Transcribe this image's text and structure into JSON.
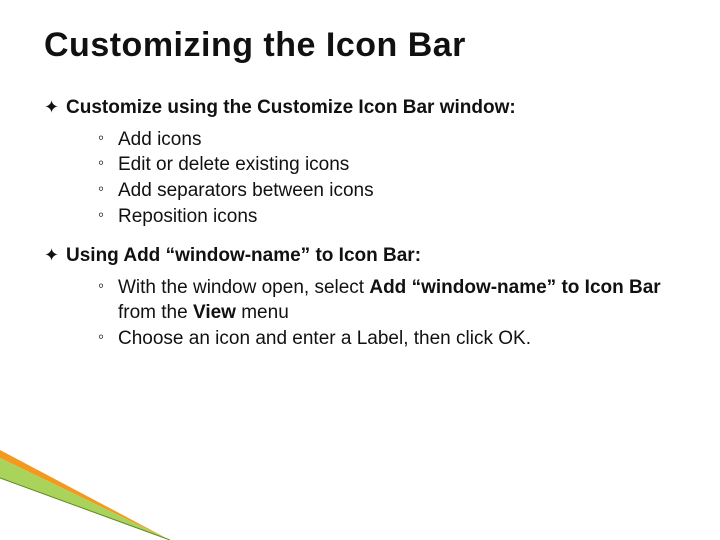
{
  "title": "Customizing the Icon Bar",
  "b1": {
    "text": "Customize using the Customize Icon Bar window:"
  },
  "s1": {
    "a": "Add icons",
    "b": "Edit or delete existing icons",
    "c": "Add separators between icons",
    "d": "Reposition icons"
  },
  "b2": {
    "text": "Using Add “window-name” to Icon Bar:"
  },
  "s2": {
    "a_pre": "With the window open, select ",
    "a_bold": "Add “window-name” to Icon Bar",
    "a_mid": " from the ",
    "a_bold2": "View",
    "a_post": " menu",
    "b": "Choose an icon and enter a Label, then click OK."
  },
  "glyphs": {
    "l1": "✦",
    "l2": "◦"
  }
}
